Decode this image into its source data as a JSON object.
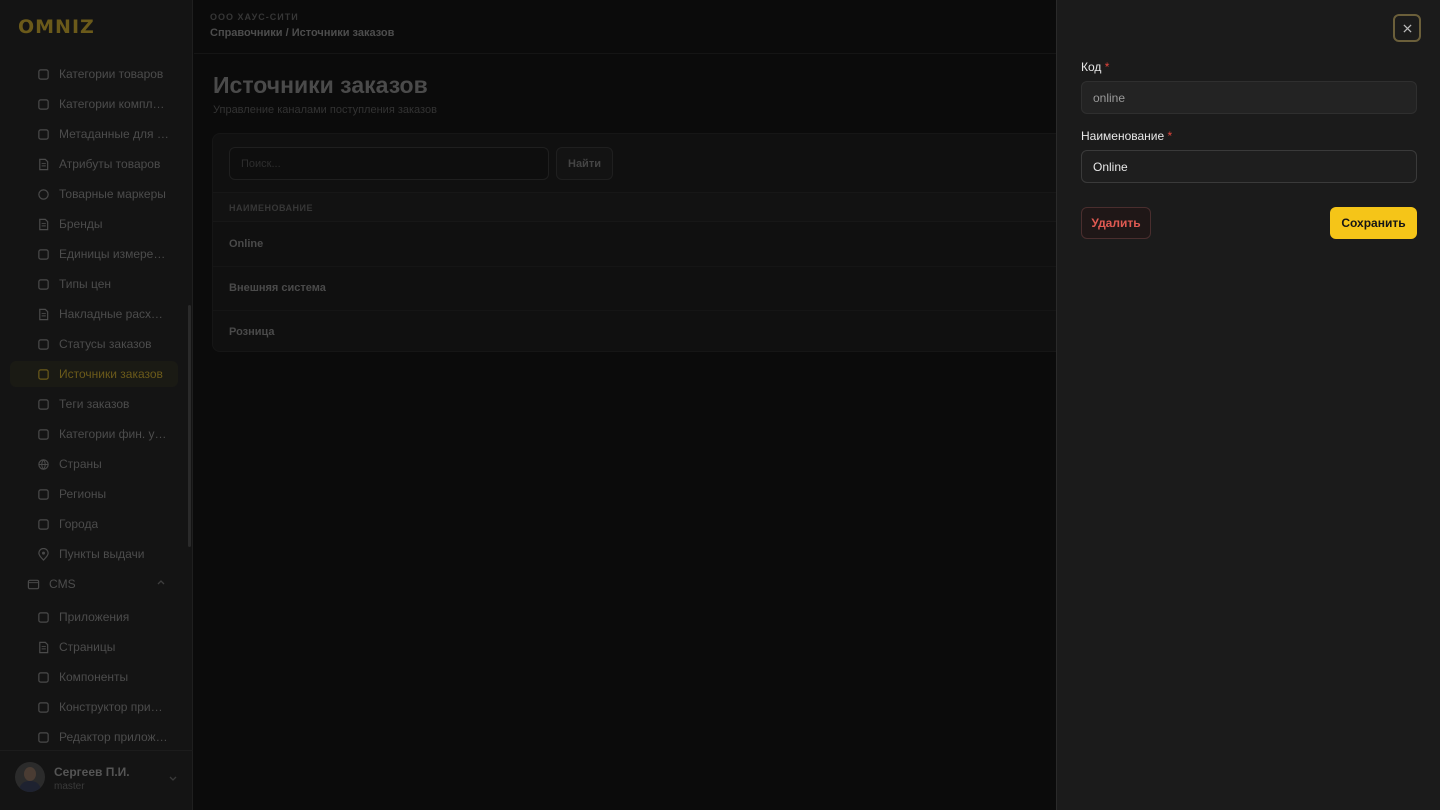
{
  "app": {
    "logo": "OMNIZ"
  },
  "sidebar": {
    "items": [
      {
        "label": "Категории товаров",
        "icon": "category-list-icon"
      },
      {
        "label": "Категории комплектов",
        "icon": "kit-icon"
      },
      {
        "label": "Метаданные для витрины",
        "icon": "sliders-icon"
      },
      {
        "label": "Атрибуты товаров",
        "icon": "document-icon"
      },
      {
        "label": "Товарные маркеры",
        "icon": "circle-icon"
      },
      {
        "label": "Бренды",
        "icon": "bookmark-icon"
      },
      {
        "label": "Единицы измерения",
        "icon": "ruler-icon"
      },
      {
        "label": "Типы цен",
        "icon": "price-tag-icon"
      },
      {
        "label": "Накладные расходы",
        "icon": "receipt-icon"
      },
      {
        "label": "Статусы заказов",
        "icon": "route-icon"
      },
      {
        "label": "Источники заказов",
        "icon": "broadcast-icon",
        "active": true
      },
      {
        "label": "Теги заказов",
        "icon": "tag-box-icon"
      },
      {
        "label": "Категории фин. учета",
        "icon": "card-icon"
      },
      {
        "label": "Страны",
        "icon": "globe-icon"
      },
      {
        "label": "Регионы",
        "icon": "map-icon"
      },
      {
        "label": "Города",
        "icon": "building-icon"
      },
      {
        "label": "Пункты выдачи",
        "icon": "pin-icon"
      }
    ],
    "cms_section": {
      "label": "CMS",
      "icon": "browser-window-icon"
    },
    "cms_items": [
      {
        "label": "Приложения",
        "icon": "magic-wand-icon"
      },
      {
        "label": "Страницы",
        "icon": "book-icon"
      },
      {
        "label": "Компоненты",
        "icon": "components-icon"
      },
      {
        "label": "Конструктор приложений",
        "icon": "tools-icon"
      },
      {
        "label": "Редактор приложений",
        "icon": "edit-icon"
      }
    ],
    "user": {
      "name": "Сергеев П.И.",
      "role": "master"
    }
  },
  "header": {
    "org": "ООО ХАУС-СИТИ",
    "breadcrumb": "Справочники / Источники заказов"
  },
  "main": {
    "title": "Источники заказов",
    "subtitle": "Управление каналами поступления заказов",
    "search_placeholder": "Поиск...",
    "find_label": "Найти",
    "column_header": "НАИМЕНОВАНИЕ",
    "rows": [
      "Online",
      "Внешняя система",
      "Розница"
    ]
  },
  "drawer": {
    "code_label": "Код",
    "code_value": "online",
    "name_label": "Наименование",
    "name_value": "Online",
    "required_mark": "*",
    "delete_label": "Удалить",
    "save_label": "Сохранить"
  },
  "colors": {
    "accent": "#f5c518",
    "danger": "#e05a52",
    "drawer_bg": "#1b1b1b"
  }
}
